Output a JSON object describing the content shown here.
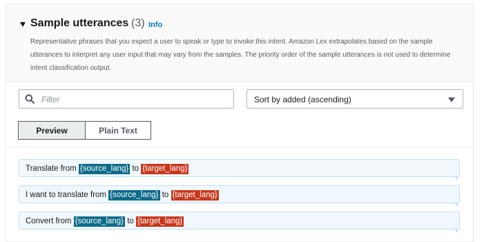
{
  "section": {
    "title": "Sample utterances",
    "count": "(3)",
    "info_label": "Info",
    "description": "Representative phrases that you expect a user to speak or type to invoke this intent. Amazon Lex extrapolates based on the sample utterances to interpret any user input that may vary from the samples. The priority order of the sample utterances is not used to determine intent classification output."
  },
  "filter": {
    "placeholder": "Filter",
    "value": ""
  },
  "sort": {
    "selected": "Sort by added (ascending)"
  },
  "tabs": [
    {
      "label": "Preview",
      "active": true
    },
    {
      "label": "Plain Text",
      "active": false
    }
  ],
  "utterances": [
    {
      "prefix": "Translate from ",
      "slot1": "{source_lang}",
      "middle": " to ",
      "slot2": "{target_lang}"
    },
    {
      "prefix": "I want to translate from ",
      "slot1": "{source_lang}",
      "middle": " to ",
      "slot2": "{target_lang}"
    },
    {
      "prefix": "Convert from ",
      "slot1": "{source_lang}",
      "middle": " to ",
      "slot2": "{target_lang}"
    }
  ],
  "colors": {
    "source_slot": "#0b6b8a",
    "target_slot": "#c7371c",
    "link": "#0073bb",
    "utterance_bg": "#f1f8fd"
  }
}
